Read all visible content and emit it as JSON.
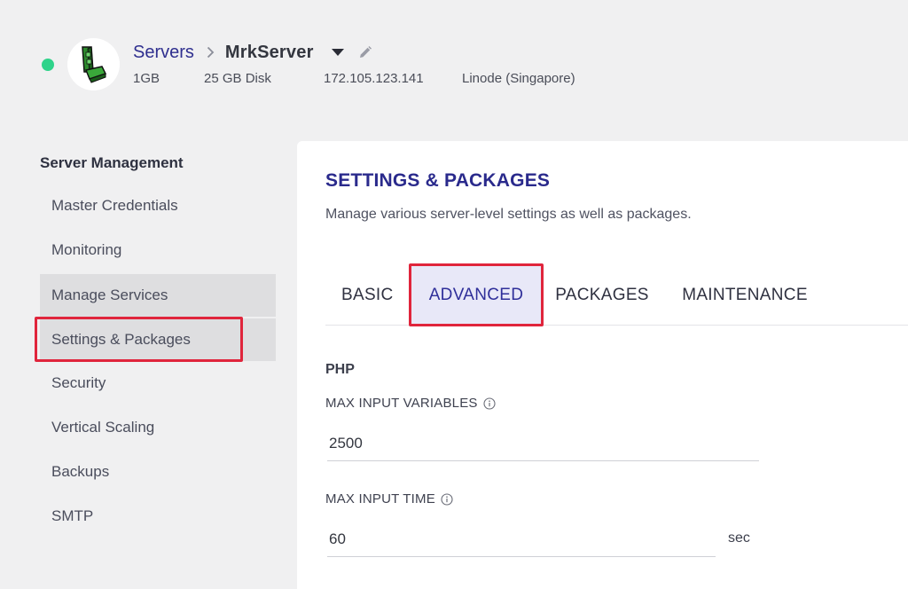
{
  "header": {
    "breadcrumb_parent": "Servers",
    "server_name": "MrkServer",
    "ram": "1GB",
    "disk": "25 GB Disk",
    "ip": "172.105.123.141",
    "location": "Linode (Singapore)",
    "status_color": "#2fd38a"
  },
  "sidebar": {
    "title": "Server Management",
    "items": [
      {
        "label": "Master Credentials"
      },
      {
        "label": "Monitoring"
      },
      {
        "label": "Manage Services"
      },
      {
        "label": "Settings & Packages"
      },
      {
        "label": "Security"
      },
      {
        "label": "Vertical Scaling"
      },
      {
        "label": "Backups"
      },
      {
        "label": "SMTP"
      }
    ]
  },
  "main": {
    "title": "SETTINGS & PACKAGES",
    "description": "Manage various server-level settings as well as packages.",
    "tabs": [
      {
        "label": "BASIC"
      },
      {
        "label": "ADVANCED"
      },
      {
        "label": "PACKAGES"
      },
      {
        "label": "MAINTENANCE"
      }
    ],
    "active_tab": "ADVANCED",
    "section": "PHP",
    "fields": [
      {
        "label": "MAX INPUT VARIABLES",
        "value": "2500"
      },
      {
        "label": "MAX INPUT TIME",
        "value": "60",
        "suffix": "sec"
      }
    ]
  },
  "colors": {
    "accent": "#2a2a8c",
    "highlight_box": "#e0253c",
    "active_tab_bg": "#e8e8f8"
  }
}
